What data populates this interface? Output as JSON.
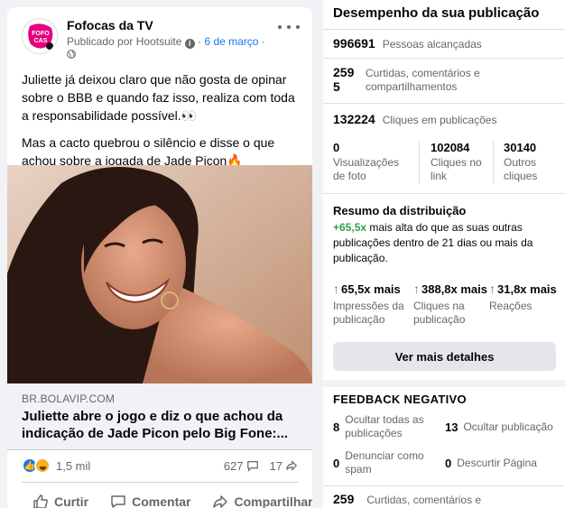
{
  "post": {
    "page_name": "Fofocas da TV",
    "avatar_text": "FOFOCAS DA TV",
    "published_by": "Publicado por Hootsuite",
    "date": "6 de março",
    "sep": "·",
    "paragraph1": "Juliette já deixou claro que não gosta de opinar sobre o BBB e quando faz isso, realiza com toda a responsabilidade possível.👀",
    "paragraph2": "Mas a cacto quebrou o silêncio e disse o que achou sobre a jogada de Jade Picon🔥",
    "link_domain": "BR.BOLAVIP.COM",
    "link_title": "Juliette abre o jogo e diz o que achou da indicação de Jade Picon pelo Big Fone:...",
    "reactions_count": "1,5 mil",
    "comments_count": "627",
    "shares_count": "17",
    "actions": {
      "like": "Curtir",
      "comment": "Comentar",
      "share": "Compartilhar"
    }
  },
  "insights": {
    "title": "Desempenho da sua publicação",
    "reach": {
      "value": "996691",
      "label": "Pessoas alcançadas"
    },
    "engagement": {
      "value1": "259",
      "value2": "5",
      "label": "Curtidas, comentários e compartilhamentos"
    },
    "clicks": {
      "value": "132224",
      "label": "Cliques em publicações"
    },
    "breakdown": [
      {
        "value": "0",
        "label": "Visualizações de foto"
      },
      {
        "value": "102084",
        "label": "Cliques no link"
      },
      {
        "value": "30140",
        "label": "Outros cliques"
      }
    ],
    "distribution": {
      "title": "Resumo da distribuição",
      "highlight": "+65,5x",
      "text": " mais alta do que as suas outras publicações dentro de 21 dias ou mais da publicação."
    },
    "multipliers": [
      {
        "value": "65,5x mais",
        "label": "Impressões da publicação"
      },
      {
        "value": "388,8x mais",
        "label": "Cliques na publicação"
      },
      {
        "value": "31,8x mais",
        "label": "Reações"
      }
    ],
    "details_button": "Ver mais detalhes",
    "negative": {
      "title": "FEEDBACK NEGATIVO",
      "items": [
        {
          "value": "8",
          "label": "Ocultar todas as publicações"
        },
        {
          "value": "13",
          "label": "Ocultar publicação"
        },
        {
          "value": "0",
          "label": "Denunciar como spam"
        },
        {
          "value": "0",
          "label": "Descurtir Página"
        }
      ]
    },
    "footer": {
      "value": "259",
      "label": "Curtidas, comentários e"
    }
  },
  "colors": {
    "accent": "#1877f2",
    "positive": "#31a24c",
    "muted": "#65676b"
  }
}
